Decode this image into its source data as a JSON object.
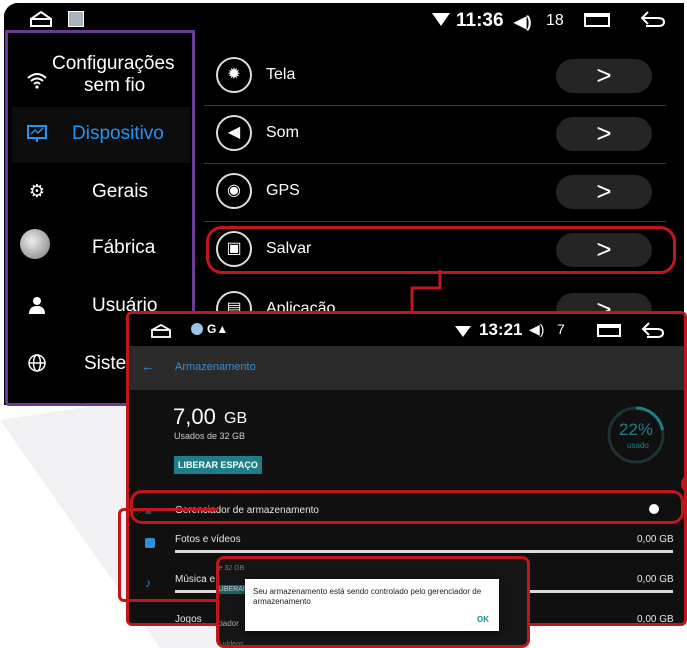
{
  "back_screen": {
    "status": {
      "time": "11:36",
      "volume": "18"
    },
    "sidebar": [
      {
        "label1": "Configurações",
        "label2": "sem fio",
        "icon": "wifi-icon"
      },
      {
        "label": "Dispositivo",
        "icon": "device-icon"
      },
      {
        "label": "Gerais",
        "icon": "gear-icon"
      },
      {
        "label": "Fábrica",
        "icon": "factory-icon"
      },
      {
        "label": "Usuário",
        "icon": "user-icon"
      },
      {
        "label": "Sistema",
        "icon": "globe-icon"
      }
    ],
    "menu": [
      {
        "label": "Tela",
        "icon": "display-icon"
      },
      {
        "label": "Som",
        "icon": "sound-icon"
      },
      {
        "label": "GPS",
        "icon": "gps-icon"
      },
      {
        "label": "Salvar",
        "icon": "save-icon"
      },
      {
        "label": "Aplicação",
        "icon": "app-icon"
      }
    ],
    "arrow_glyph": ">"
  },
  "storage_screen": {
    "status": {
      "time": "13:21",
      "volume": "7"
    },
    "title": "Armazenamento",
    "used_value": "7,00",
    "used_unit": "GB",
    "used_sub": "Usados de 32 GB",
    "free_button": "LIBERAR ESPAÇO",
    "percent": "22%",
    "percent_label": "usado",
    "percent_fraction": 0.22,
    "manager_label": "Gerenciador de armazenamento",
    "categories": [
      {
        "label": "Fotos e vídeos",
        "value": "0,00 GB",
        "icon": "photo-icon"
      },
      {
        "label": "Música e",
        "value": "0,00 GB",
        "icon": "music-icon"
      },
      {
        "label": "Jogos",
        "value": "0,00 GB",
        "icon": "games-icon"
      }
    ],
    "ghost_texts": [
      "le 32 GB",
      "LIBERAR ESPA",
      "ciador",
      "e vídeos"
    ]
  },
  "dialog": {
    "message": "Seu armazenamento está sendo controlado pelo gerenciador de armazenamento",
    "ok": "OK"
  },
  "colors": {
    "highlight": "#c0161c",
    "accent": "#2196f3",
    "teal": "#1f7f87",
    "purple": "#6a3a96"
  }
}
